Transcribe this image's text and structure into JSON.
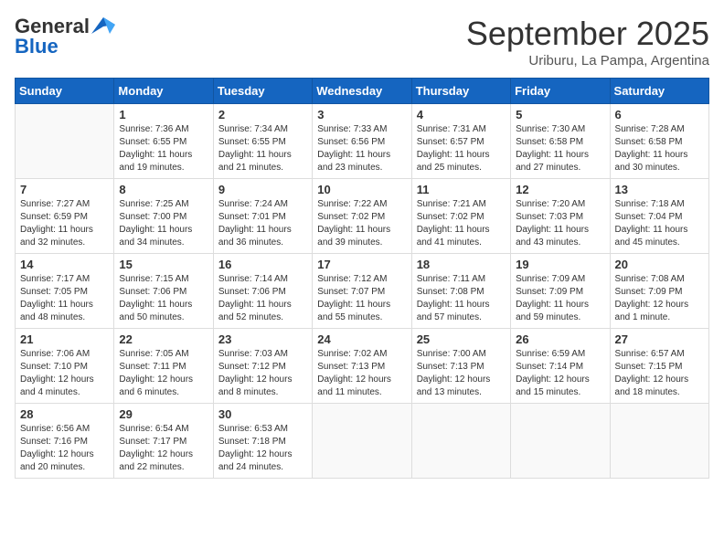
{
  "logo": {
    "general": "General",
    "blue": "Blue"
  },
  "title": "September 2025",
  "subtitle": "Uriburu, La Pampa, Argentina",
  "days_of_week": [
    "Sunday",
    "Monday",
    "Tuesday",
    "Wednesday",
    "Thursday",
    "Friday",
    "Saturday"
  ],
  "weeks": [
    [
      {
        "day": "",
        "info": ""
      },
      {
        "day": "1",
        "info": "Sunrise: 7:36 AM\nSunset: 6:55 PM\nDaylight: 11 hours\nand 19 minutes."
      },
      {
        "day": "2",
        "info": "Sunrise: 7:34 AM\nSunset: 6:55 PM\nDaylight: 11 hours\nand 21 minutes."
      },
      {
        "day": "3",
        "info": "Sunrise: 7:33 AM\nSunset: 6:56 PM\nDaylight: 11 hours\nand 23 minutes."
      },
      {
        "day": "4",
        "info": "Sunrise: 7:31 AM\nSunset: 6:57 PM\nDaylight: 11 hours\nand 25 minutes."
      },
      {
        "day": "5",
        "info": "Sunrise: 7:30 AM\nSunset: 6:58 PM\nDaylight: 11 hours\nand 27 minutes."
      },
      {
        "day": "6",
        "info": "Sunrise: 7:28 AM\nSunset: 6:58 PM\nDaylight: 11 hours\nand 30 minutes."
      }
    ],
    [
      {
        "day": "7",
        "info": "Sunrise: 7:27 AM\nSunset: 6:59 PM\nDaylight: 11 hours\nand 32 minutes."
      },
      {
        "day": "8",
        "info": "Sunrise: 7:25 AM\nSunset: 7:00 PM\nDaylight: 11 hours\nand 34 minutes."
      },
      {
        "day": "9",
        "info": "Sunrise: 7:24 AM\nSunset: 7:01 PM\nDaylight: 11 hours\nand 36 minutes."
      },
      {
        "day": "10",
        "info": "Sunrise: 7:22 AM\nSunset: 7:02 PM\nDaylight: 11 hours\nand 39 minutes."
      },
      {
        "day": "11",
        "info": "Sunrise: 7:21 AM\nSunset: 7:02 PM\nDaylight: 11 hours\nand 41 minutes."
      },
      {
        "day": "12",
        "info": "Sunrise: 7:20 AM\nSunset: 7:03 PM\nDaylight: 11 hours\nand 43 minutes."
      },
      {
        "day": "13",
        "info": "Sunrise: 7:18 AM\nSunset: 7:04 PM\nDaylight: 11 hours\nand 45 minutes."
      }
    ],
    [
      {
        "day": "14",
        "info": "Sunrise: 7:17 AM\nSunset: 7:05 PM\nDaylight: 11 hours\nand 48 minutes."
      },
      {
        "day": "15",
        "info": "Sunrise: 7:15 AM\nSunset: 7:06 PM\nDaylight: 11 hours\nand 50 minutes."
      },
      {
        "day": "16",
        "info": "Sunrise: 7:14 AM\nSunset: 7:06 PM\nDaylight: 11 hours\nand 52 minutes."
      },
      {
        "day": "17",
        "info": "Sunrise: 7:12 AM\nSunset: 7:07 PM\nDaylight: 11 hours\nand 55 minutes."
      },
      {
        "day": "18",
        "info": "Sunrise: 7:11 AM\nSunset: 7:08 PM\nDaylight: 11 hours\nand 57 minutes."
      },
      {
        "day": "19",
        "info": "Sunrise: 7:09 AM\nSunset: 7:09 PM\nDaylight: 11 hours\nand 59 minutes."
      },
      {
        "day": "20",
        "info": "Sunrise: 7:08 AM\nSunset: 7:09 PM\nDaylight: 12 hours\nand 1 minute."
      }
    ],
    [
      {
        "day": "21",
        "info": "Sunrise: 7:06 AM\nSunset: 7:10 PM\nDaylight: 12 hours\nand 4 minutes."
      },
      {
        "day": "22",
        "info": "Sunrise: 7:05 AM\nSunset: 7:11 PM\nDaylight: 12 hours\nand 6 minutes."
      },
      {
        "day": "23",
        "info": "Sunrise: 7:03 AM\nSunset: 7:12 PM\nDaylight: 12 hours\nand 8 minutes."
      },
      {
        "day": "24",
        "info": "Sunrise: 7:02 AM\nSunset: 7:13 PM\nDaylight: 12 hours\nand 11 minutes."
      },
      {
        "day": "25",
        "info": "Sunrise: 7:00 AM\nSunset: 7:13 PM\nDaylight: 12 hours\nand 13 minutes."
      },
      {
        "day": "26",
        "info": "Sunrise: 6:59 AM\nSunset: 7:14 PM\nDaylight: 12 hours\nand 15 minutes."
      },
      {
        "day": "27",
        "info": "Sunrise: 6:57 AM\nSunset: 7:15 PM\nDaylight: 12 hours\nand 18 minutes."
      }
    ],
    [
      {
        "day": "28",
        "info": "Sunrise: 6:56 AM\nSunset: 7:16 PM\nDaylight: 12 hours\nand 20 minutes."
      },
      {
        "day": "29",
        "info": "Sunrise: 6:54 AM\nSunset: 7:17 PM\nDaylight: 12 hours\nand 22 minutes."
      },
      {
        "day": "30",
        "info": "Sunrise: 6:53 AM\nSunset: 7:18 PM\nDaylight: 12 hours\nand 24 minutes."
      },
      {
        "day": "",
        "info": ""
      },
      {
        "day": "",
        "info": ""
      },
      {
        "day": "",
        "info": ""
      },
      {
        "day": "",
        "info": ""
      }
    ]
  ]
}
